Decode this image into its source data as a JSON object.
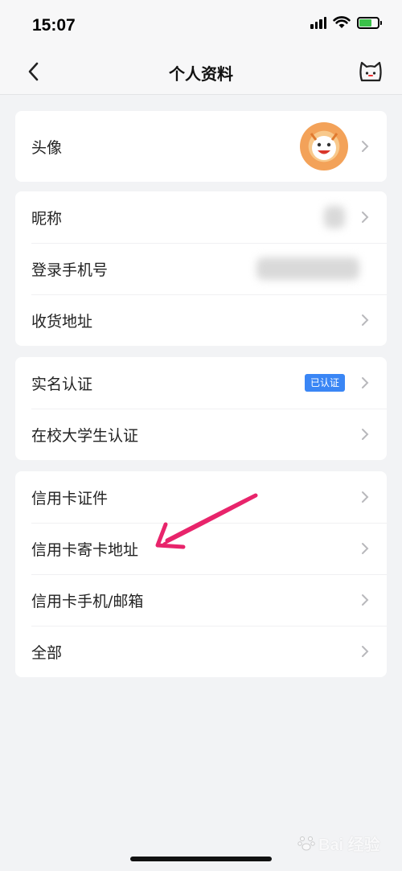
{
  "status_bar": {
    "time": "15:07",
    "battery_level": 0.7,
    "battery_color": "#3bc14a"
  },
  "nav": {
    "title": "个人资料",
    "back_icon": "chevron-left-icon",
    "right_icon": "cat-face-icon"
  },
  "sections": {
    "avatar": {
      "label": "头像"
    },
    "basic": [
      {
        "label": "昵称"
      },
      {
        "label": "登录手机号"
      },
      {
        "label": "收货地址"
      }
    ],
    "verify": [
      {
        "label": "实名认证",
        "badge": "已认证"
      },
      {
        "label": "在校大学生认证"
      }
    ],
    "credit": [
      {
        "label": "信用卡证件"
      },
      {
        "label": "信用卡寄卡地址"
      },
      {
        "label": "信用卡手机/邮箱"
      },
      {
        "label": "全部"
      }
    ]
  },
  "colors": {
    "badge": "#3a86f5",
    "annotation_arrow": "#e8246b",
    "background": "#f2f3f5"
  },
  "watermark": {
    "text": "Bai 经验"
  }
}
